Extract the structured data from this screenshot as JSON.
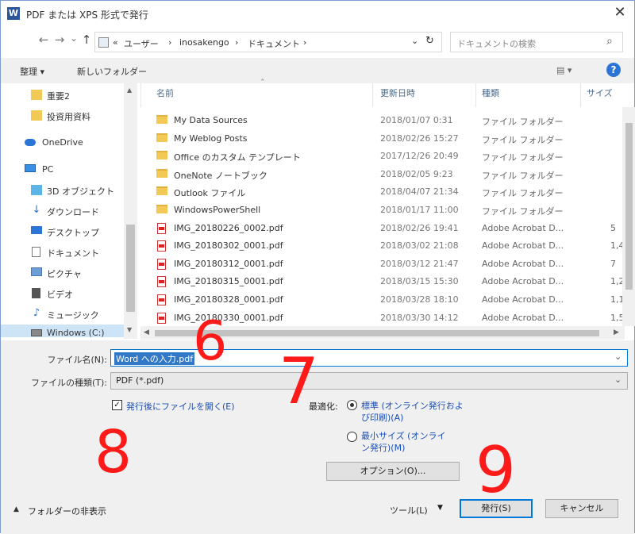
{
  "window": {
    "title": "PDF または XPS 形式で発行",
    "close": "✕"
  },
  "nav": {
    "back": "←",
    "forward": "→",
    "dropdown": "⌄",
    "up": "↑"
  },
  "address": {
    "segments": [
      "«",
      "ユーザー",
      "›",
      "inosakengo",
      "›",
      "ドキュメント",
      "›"
    ],
    "dropdown": "⌄",
    "refresh": "↻"
  },
  "search": {
    "placeholder": "ドキュメントの検索",
    "icon": "⌕"
  },
  "toolbar": {
    "organize": "整理 ▾",
    "new_folder": "新しいフォルダー",
    "view": "▤ ▾",
    "help": "?"
  },
  "sidebar": {
    "items": [
      {
        "label": "重要2",
        "icon": "folder-icon"
      },
      {
        "label": "投資用資料",
        "icon": "folder-icon"
      },
      {
        "label": "OneDrive",
        "icon": "cloud-icon"
      },
      {
        "label": "PC",
        "icon": "pc-icon"
      },
      {
        "label": "3D オブジェクト",
        "icon": "cube-icon"
      },
      {
        "label": "ダウンロード",
        "icon": "download-icon"
      },
      {
        "label": "デスクトップ",
        "icon": "desktop-icon"
      },
      {
        "label": "ドキュメント",
        "icon": "document-icon"
      },
      {
        "label": "ピクチャ",
        "icon": "picture-icon"
      },
      {
        "label": "ビデオ",
        "icon": "video-icon"
      },
      {
        "label": "ミュージック",
        "icon": "music-icon"
      },
      {
        "label": "Windows (C:)",
        "icon": "drive-icon"
      }
    ]
  },
  "columns": {
    "name": "名前",
    "date": "更新日時",
    "type": "種類",
    "size": "サイズ"
  },
  "files": [
    {
      "name": "My Data Sources",
      "date": "2018/01/07 0:31",
      "type": "ファイル フォルダー",
      "size": "",
      "kind": "folder"
    },
    {
      "name": "My Weblog Posts",
      "date": "2018/02/26 15:27",
      "type": "ファイル フォルダー",
      "size": "",
      "kind": "folder"
    },
    {
      "name": "Office のカスタム テンプレート",
      "date": "2017/12/26 20:49",
      "type": "ファイル フォルダー",
      "size": "",
      "kind": "folder"
    },
    {
      "name": "OneNote ノートブック",
      "date": "2018/02/05 9:23",
      "type": "ファイル フォルダー",
      "size": "",
      "kind": "folder"
    },
    {
      "name": "Outlook ファイル",
      "date": "2018/04/07 21:34",
      "type": "ファイル フォルダー",
      "size": "",
      "kind": "folder"
    },
    {
      "name": "WindowsPowerShell",
      "date": "2018/01/17 11:00",
      "type": "ファイル フォルダー",
      "size": "",
      "kind": "folder"
    },
    {
      "name": "IMG_20180226_0002.pdf",
      "date": "2018/02/26 19:41",
      "type": "Adobe Acrobat D...",
      "size": "5",
      "kind": "pdf"
    },
    {
      "name": "IMG_20180302_0001.pdf",
      "date": "2018/03/02 21:08",
      "type": "Adobe Acrobat D...",
      "size": "1,4",
      "kind": "pdf"
    },
    {
      "name": "IMG_20180312_0001.pdf",
      "date": "2018/03/12 21:47",
      "type": "Adobe Acrobat D...",
      "size": "7",
      "kind": "pdf"
    },
    {
      "name": "IMG_20180315_0001.pdf",
      "date": "2018/03/15 15:30",
      "type": "Adobe Acrobat D...",
      "size": "1,2",
      "kind": "pdf"
    },
    {
      "name": "IMG_20180328_0001.pdf",
      "date": "2018/03/28 18:10",
      "type": "Adobe Acrobat D...",
      "size": "1,1",
      "kind": "pdf"
    },
    {
      "name": "IMG_20180330_0001.pdf",
      "date": "2018/03/30 14:12",
      "type": "Adobe Acrobat D...",
      "size": "1,5",
      "kind": "pdf"
    }
  ],
  "form": {
    "filename_label": "ファイル名(N):",
    "filename_value": "Word への入力.pdf",
    "filetype_label": "ファイルの種類(T):",
    "filetype_value": "PDF (*.pdf)",
    "open_after_label": "発行後にファイルを開く(E)",
    "optimize_label": "最適化:",
    "standard_label": "標準 (オンライン発行および印刷)(A)",
    "minimum_label": "最小サイズ (オンライン発行)(M)",
    "options_button": "オプション(O)...",
    "hide_folders": "フォルダーの非表示",
    "tools_button": "ツール(L)",
    "publish_button": "発行(S)",
    "cancel_button": "キャンセル",
    "dropdown_arrow": "⌄"
  },
  "annotations": {
    "a6": "6",
    "a7": "7",
    "a8": "8",
    "a9": "9"
  },
  "colors": {
    "annotation": "#ff1a1a",
    "accent": "#0078d7",
    "selection": "#3178c6"
  }
}
